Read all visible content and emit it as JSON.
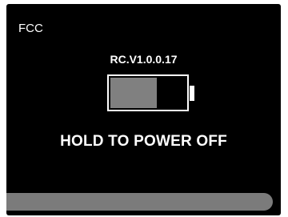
{
  "screen": {
    "region_label": "FCC",
    "firmware_version": "RC.V1.0.0.17",
    "message": "HOLD TO POWER OFF"
  },
  "battery": {
    "icon": "battery-icon",
    "level_fraction": 0.62,
    "fill_color": "#808080",
    "outline_color": "#ffffff"
  },
  "power_off_progress": {
    "level_fraction": 0.97,
    "fill_color": "#7b7b7b"
  },
  "colors": {
    "background": "#000000",
    "text": "#ffffff"
  }
}
